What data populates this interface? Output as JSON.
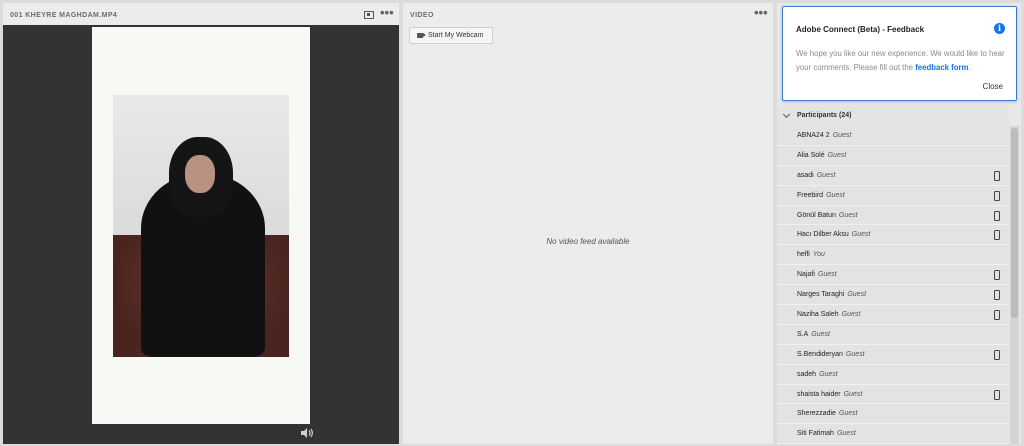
{
  "share_pod": {
    "title": "001 KHEYRE MAGHDAM.MP4",
    "menu_glyph": "•••"
  },
  "video_pod": {
    "title": "VIDEO",
    "menu_glyph": "•••",
    "webcam_button": "Start My Webcam",
    "no_feed_text": "No video feed available"
  },
  "feedback": {
    "title": "Adobe Connect (Beta) - Feedback",
    "info_glyph": "i",
    "body_before": "We hope you like our new experience. We would like to hear your comments. Please fill out the ",
    "link_text": "feedback form",
    "body_after": ".",
    "close_label": "Close"
  },
  "participants": {
    "header": "Participants (24)",
    "list": [
      {
        "name": "ABNA24 2",
        "role": "Guest",
        "mobile": false
      },
      {
        "name": "Alia Solé",
        "role": "Guest",
        "mobile": false
      },
      {
        "name": "asadi",
        "role": "Guest",
        "mobile": true
      },
      {
        "name": "Freebird",
        "role": "Guest",
        "mobile": true
      },
      {
        "name": "Gönül Batun",
        "role": "Guest",
        "mobile": true
      },
      {
        "name": "Hacı Dilber Aksu",
        "role": "Guest",
        "mobile": true
      },
      {
        "name": "helfi",
        "role": "You",
        "mobile": false
      },
      {
        "name": "Najafi",
        "role": "Guest",
        "mobile": true
      },
      {
        "name": "Narges Taraghi",
        "role": "Guest",
        "mobile": true
      },
      {
        "name": "Naziha Saleh",
        "role": "Guest",
        "mobile": true
      },
      {
        "name": "S.A",
        "role": "Guest",
        "mobile": false
      },
      {
        "name": "S.Bendideryan",
        "role": "Guest",
        "mobile": true
      },
      {
        "name": "sadeh",
        "role": "Guest",
        "mobile": false
      },
      {
        "name": "shaista haider",
        "role": "Guest",
        "mobile": true
      },
      {
        "name": "Sherezzadie",
        "role": "Guest",
        "mobile": false
      },
      {
        "name": "Siti Fatimah",
        "role": "Guest",
        "mobile": false
      }
    ]
  },
  "colors": {
    "accent": "#1473e6",
    "feedback_border": "#3a78c9"
  }
}
